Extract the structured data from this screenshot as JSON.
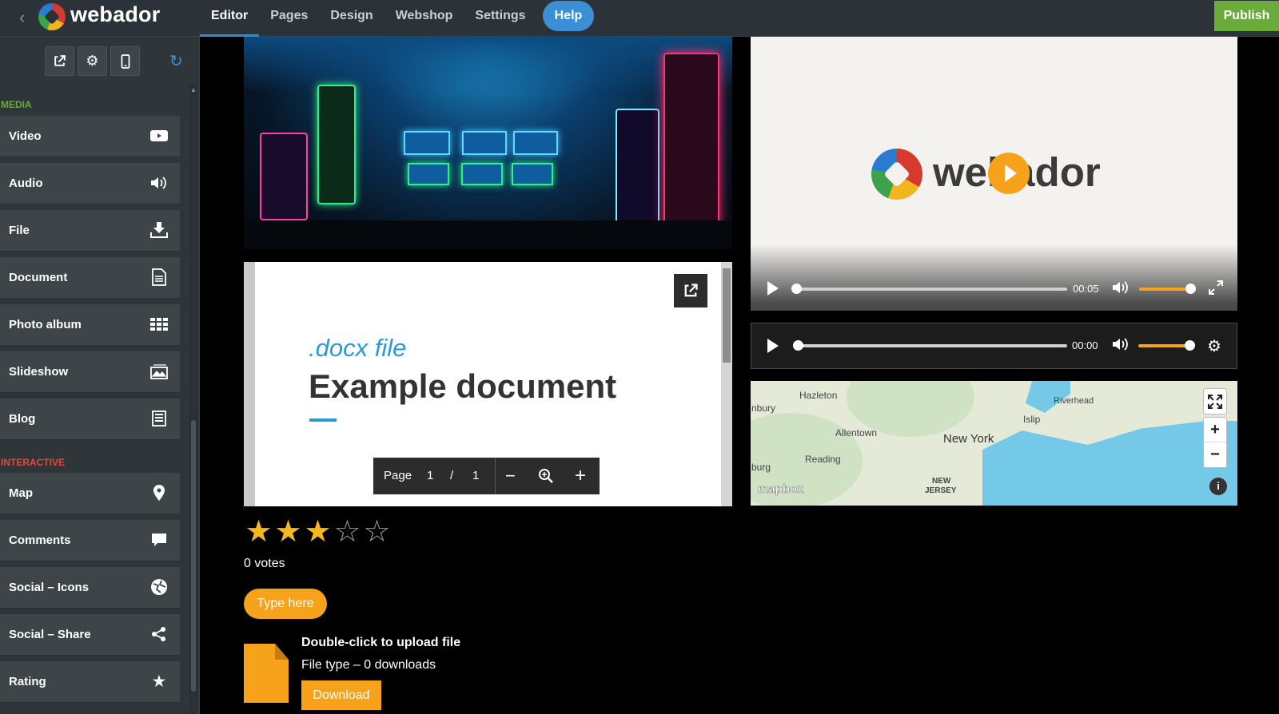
{
  "topbar": {
    "logo": "webador",
    "nav": [
      "Editor",
      "Pages",
      "Design",
      "Webshop",
      "Settings"
    ],
    "active_nav": "Editor",
    "help": "Help",
    "publish": "Publish"
  },
  "sidebar": {
    "tools": [
      "external-link-icon",
      "gear-icon",
      "mobile-icon",
      "refresh-icon"
    ],
    "sections": [
      {
        "label": "MEDIA",
        "color": "#6aab3c",
        "items": [
          {
            "label": "Video",
            "icon": "video-icon"
          },
          {
            "label": "Audio",
            "icon": "speaker-icon"
          },
          {
            "label": "File",
            "icon": "download-icon"
          },
          {
            "label": "Document",
            "icon": "document-icon"
          },
          {
            "label": "Photo album",
            "icon": "grid-icon"
          },
          {
            "label": "Slideshow",
            "icon": "slideshow-icon"
          },
          {
            "label": "Blog",
            "icon": "blog-icon"
          }
        ]
      },
      {
        "label": "INTERACTIVE",
        "color": "#e5473a",
        "items": [
          {
            "label": "Map",
            "icon": "map-pin-icon"
          },
          {
            "label": "Comments",
            "icon": "comment-icon"
          },
          {
            "label": "Social – Icons",
            "icon": "globe-icon"
          },
          {
            "label": "Social – Share",
            "icon": "share-icon"
          },
          {
            "label": "Rating",
            "icon": "star-icon"
          }
        ]
      }
    ]
  },
  "document": {
    "ext": ".docx file",
    "title": "Example document",
    "pager": {
      "label": "Page",
      "current": "1",
      "sep": "/",
      "total": "1"
    }
  },
  "rating": {
    "stars_filled": 3,
    "stars_total": 5,
    "votes": "0 votes"
  },
  "button": {
    "label": "Type here"
  },
  "file_block": {
    "title": "Double-click to upload file",
    "meta": "File type – 0 downloads",
    "download": "Download"
  },
  "video": {
    "logo": "webador",
    "time": "00:05"
  },
  "audio": {
    "time": "00:00"
  },
  "map": {
    "labels": [
      "Hazleton",
      "nbury",
      "Allentown",
      "Reading",
      "burg",
      "New York",
      "Islip",
      "Riverhead",
      "NEW",
      "JERSEY"
    ],
    "attribution": "mapbox"
  },
  "colors": {
    "accent": "#f6a21a",
    "primary": "#3a8fd6",
    "publish": "#6aab3c"
  }
}
